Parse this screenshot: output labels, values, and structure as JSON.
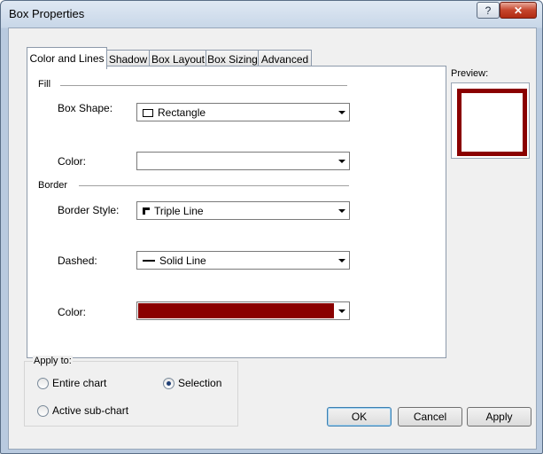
{
  "window": {
    "title": "Box Properties",
    "help_label": "?",
    "close_label": "✕"
  },
  "tabs": [
    {
      "label": "Color and Lines",
      "active": true
    },
    {
      "label": "Shadow",
      "active": false
    },
    {
      "label": "Box Layout",
      "active": false
    },
    {
      "label": "Box Sizing",
      "active": false
    },
    {
      "label": "Advanced",
      "active": false
    }
  ],
  "fill": {
    "group_label": "Fill",
    "box_shape": {
      "label": "Box Shape:",
      "value": "Rectangle",
      "icon": "rectangle-icon"
    },
    "color": {
      "label": "Color:",
      "value": ""
    }
  },
  "border": {
    "group_label": "Border",
    "border_style": {
      "label": "Border Style:",
      "value": "Triple Line",
      "icon": "triple-line-icon"
    },
    "dashed": {
      "label": "Dashed:",
      "value": "Solid Line",
      "icon": "solid-line-icon"
    },
    "color": {
      "label": "Color:",
      "value": "#8a0000"
    }
  },
  "preview": {
    "label": "Preview:",
    "border_color": "#8a0000"
  },
  "apply_to": {
    "title": "Apply to:",
    "options": [
      {
        "label": "Entire chart",
        "selected": false
      },
      {
        "label": "Selection",
        "selected": true
      },
      {
        "label": "Active sub-chart",
        "selected": false
      }
    ]
  },
  "buttons": {
    "ok": "OK",
    "cancel": "Cancel",
    "apply": "Apply"
  }
}
